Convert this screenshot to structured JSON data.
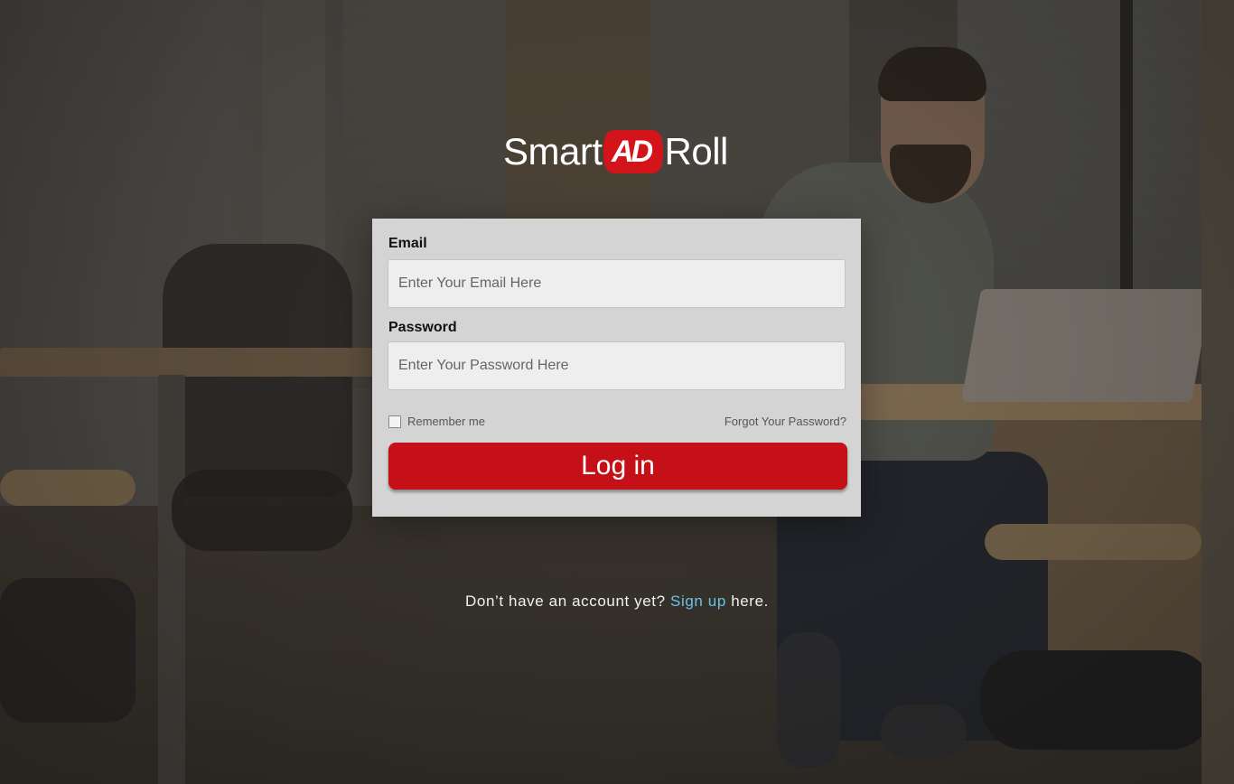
{
  "brand": {
    "logo_left": "Smart",
    "logo_badge": "AD",
    "logo_right": "Roll",
    "badge_color": "#d4141b"
  },
  "login_form": {
    "email_label": "Email",
    "email_placeholder": "Enter Your Email Here",
    "email_value": "",
    "password_label": "Password",
    "password_placeholder": "Enter Your Password Here",
    "password_value": "",
    "remember_label": "Remember me",
    "remember_checked": false,
    "forgot_label": "Forgot Your Password?",
    "submit_label": "Log in",
    "accent_color": "#c41016"
  },
  "signup": {
    "prefix": "Don’t have an account yet?",
    "link_label": "Sign up",
    "suffix": "here.",
    "link_color": "#6cc0e8"
  }
}
